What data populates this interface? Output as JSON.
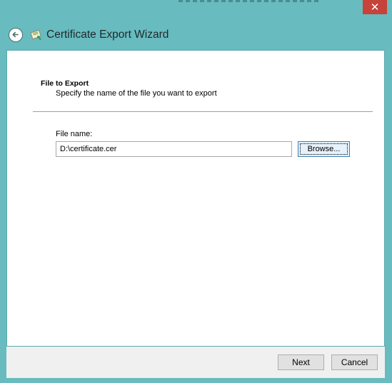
{
  "window": {
    "title": "Certificate Export Wizard",
    "close_symbol": "✕"
  },
  "page": {
    "heading": "File to Export",
    "subheading": "Specify the name of the file you want to export"
  },
  "form": {
    "file_name_label": "File name:",
    "file_name_value": "D:\\certificate.cer",
    "browse_label": "Browse..."
  },
  "footer": {
    "next_label": "Next",
    "cancel_label": "Cancel"
  },
  "colors": {
    "frame": "#68bbbe",
    "close": "#c7423a",
    "focus_border": "#3c7fb1"
  },
  "icons": {
    "back": "back-arrow-icon",
    "wizard": "certificate-icon",
    "close": "close-icon"
  }
}
